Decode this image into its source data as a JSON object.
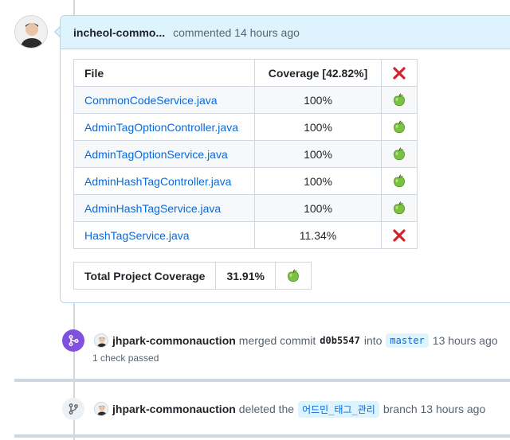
{
  "comment": {
    "author": "incheol-commo...",
    "action": "commented 14 hours ago",
    "table": {
      "headers": [
        "File",
        "Coverage [42.82%]"
      ],
      "header_status": "fail",
      "rows": [
        {
          "file": "CommonCodeService.java",
          "coverage": "100%",
          "status": "pass"
        },
        {
          "file": "AdminTagOptionController.java",
          "coverage": "100%",
          "status": "pass"
        },
        {
          "file": "AdminTagOptionService.java",
          "coverage": "100%",
          "status": "pass"
        },
        {
          "file": "AdminHashTagController.java",
          "coverage": "100%",
          "status": "pass"
        },
        {
          "file": "AdminHashTagService.java",
          "coverage": "100%",
          "status": "pass"
        },
        {
          "file": "HashTagService.java",
          "coverage": "11.34%",
          "status": "fail"
        }
      ]
    },
    "total": {
      "label": "Total Project Coverage",
      "value": "31.91%",
      "status": "pass"
    }
  },
  "merge_event": {
    "icon": "git-merge-icon",
    "actor": "jhpark-commonauction",
    "text_before": "merged commit",
    "sha": "d0b5547",
    "text_into": "into",
    "branch": "master",
    "time": "13 hours ago",
    "checks": "1 check passed"
  },
  "delete_event": {
    "icon": "git-branch-icon",
    "actor": "jhpark-commonauction",
    "text_before": "deleted the",
    "branch": "어드민_태그_관리",
    "text_after": "branch 13 hours ago"
  },
  "colors": {
    "merged": "#8250df",
    "link": "#0969da",
    "header_bg": "#ddf4ff",
    "fail": "#d1242f",
    "pass": "#6cc644"
  }
}
